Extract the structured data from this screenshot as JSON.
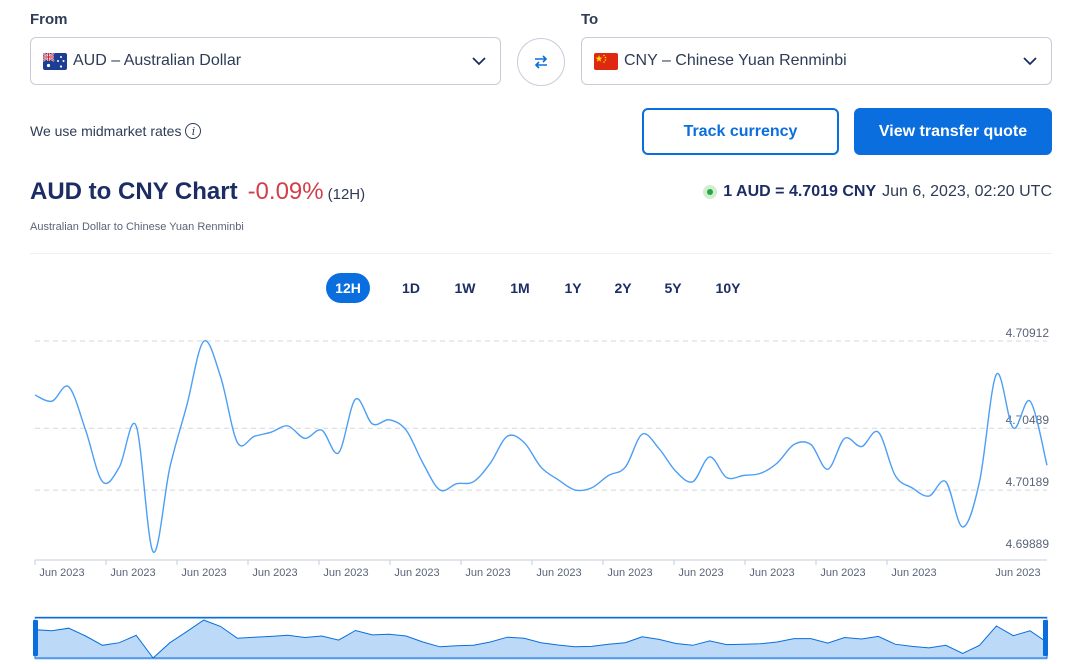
{
  "converter": {
    "from_label": "From",
    "to_label": "To",
    "from_value": "AUD – Australian Dollar",
    "to_value": "CNY – Chinese Yuan Renminbi",
    "from_flag": "australia-flag",
    "to_flag": "china-flag",
    "midmarket_text": "We use midmarket rates",
    "track_button": "Track currency",
    "quote_button": "View transfer quote"
  },
  "header": {
    "chart_title": "AUD to CNY Chart",
    "change": "-0.09%",
    "period": "(12H)",
    "subtitle": "Australian Dollar to Chinese Yuan Renminbi",
    "rate_text": "1 AUD = 4.7019 CNY",
    "timestamp": "Jun 6, 2023, 02:20 UTC"
  },
  "ranges": [
    "12H",
    "1D",
    "1W",
    "1M",
    "1Y",
    "2Y",
    "5Y",
    "10Y"
  ],
  "active_range": "12H",
  "colors": {
    "accent": "#0a6ede",
    "negative": "#d13f4b",
    "line": "#4d9ef5",
    "navigator_fill": "#bcdaf8"
  },
  "chart_data": {
    "type": "line",
    "y_ticks": [
      "4.70912",
      "4.70489",
      "4.70189",
      "4.69889"
    ],
    "x_ticks": [
      "Jun 2023",
      "Jun 2023",
      "Jun 2023",
      "Jun 2023",
      "Jun 2023",
      "Jun 2023",
      "Jun 2023",
      "Jun 2023",
      "Jun 2023",
      "Jun 2023",
      "Jun 2023",
      "Jun 2023",
      "Jun 2023",
      "Jun 2023"
    ],
    "ylim": [
      4.69889,
      4.70912
    ],
    "grid": true,
    "series": [
      {
        "values": [
          4.7065,
          4.7062,
          4.7069,
          4.7048,
          4.7023,
          4.703,
          4.705,
          4.6989,
          4.703,
          4.706,
          4.7091,
          4.7074,
          4.7042,
          4.7045,
          4.7047,
          4.705,
          4.7044,
          4.7048,
          4.7037,
          4.7063,
          4.7051,
          4.7053,
          4.7048,
          4.7032,
          4.7019,
          4.7022,
          4.7023,
          4.7032,
          4.7045,
          4.7042,
          4.703,
          4.7024,
          4.7019,
          4.702,
          4.7026,
          4.703,
          4.7046,
          4.7039,
          4.7028,
          4.7023,
          4.7035,
          4.7025,
          4.7026,
          4.7027,
          4.7032,
          4.7041,
          4.7041,
          4.7029,
          4.7044,
          4.704,
          4.7047,
          4.7026,
          4.702,
          4.7016,
          4.7023,
          4.7001,
          4.7023,
          4.7075,
          4.7049,
          4.7062,
          4.7031
        ]
      }
    ]
  }
}
